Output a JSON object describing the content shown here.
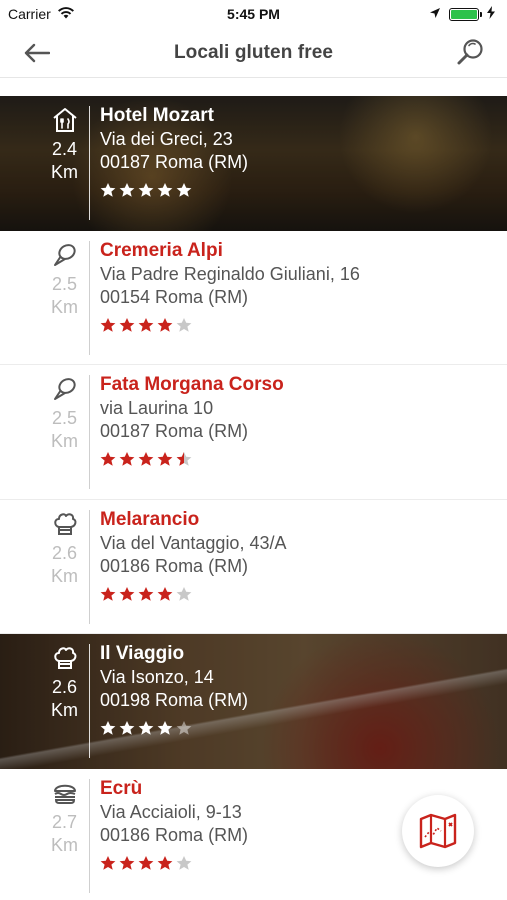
{
  "status_bar": {
    "carrier": "Carrier",
    "time": "5:45 PM",
    "battery_level": 1.0
  },
  "nav": {
    "title": "Locali gluten free"
  },
  "colors": {
    "accent": "#c9231c",
    "muted": "#bdbdbd",
    "star_empty": "#c8c8c8"
  },
  "items": [
    {
      "name": "Hotel Mozart",
      "address_line1": "Via dei Greci, 23",
      "address_line2": "00187 Roma (RM)",
      "distance": "2.4",
      "unit": "Km",
      "icon": "hotel-icon",
      "rating": 5,
      "photo": true
    },
    {
      "name": "Cremeria Alpi",
      "address_line1": "Via Padre Reginaldo Giuliani, 16",
      "address_line2": "00154 Roma (RM)",
      "distance": "2.5",
      "unit": "Km",
      "icon": "ice-cream-icon",
      "rating": 4,
      "photo": false
    },
    {
      "name": "Fata Morgana Corso",
      "address_line1": "via Laurina 10",
      "address_line2": "00187 Roma (RM)",
      "distance": "2.5",
      "unit": "Km",
      "icon": "ice-cream-icon",
      "rating": 4.5,
      "photo": false
    },
    {
      "name": "Melarancio",
      "address_line1": "Via del Vantaggio, 43/A",
      "address_line2": "00186 Roma (RM)",
      "distance": "2.6",
      "unit": "Km",
      "icon": "chef-hat-icon",
      "rating": 4,
      "photo": false
    },
    {
      "name": "Il Viaggio",
      "address_line1": "Via Isonzo, 14",
      "address_line2": "00198 Roma (RM)",
      "distance": "2.6",
      "unit": "Km",
      "icon": "chef-hat-icon",
      "rating": 4,
      "photo": true
    },
    {
      "name": "Ecrù",
      "address_line1": "Via Acciaioli, 9-13",
      "address_line2": "00186 Roma (RM)",
      "distance": "2.7",
      "unit": "Km",
      "icon": "burger-icon",
      "rating": 4,
      "photo": false
    }
  ]
}
